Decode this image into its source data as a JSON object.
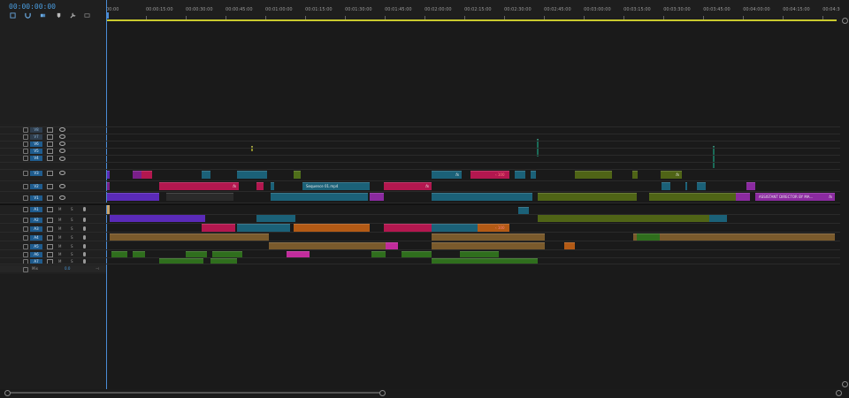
{
  "timecode": "00:00:00:00",
  "ruler": {
    "labels": [
      "00:00",
      "00:00:15:00",
      "00:00:30:00",
      "00:00:45:00",
      "00:01:00:00",
      "00:01:15:00",
      "00:01:30:00",
      "00:01:45:00",
      "00:02:00:00",
      "00:02:15:00",
      "00:02:30:00",
      "00:02:45:00",
      "00:03:00:00",
      "00:03:15:00",
      "00:03:30:00",
      "00:03:45:00",
      "00:04:00:00",
      "00:04:15:00",
      "00:04:30:00"
    ]
  },
  "video_tracks": [
    "V8",
    "V7",
    "V6",
    "V5",
    "V4",
    "V3",
    "V2",
    "V1"
  ],
  "audio_tracks": [
    "A1",
    "A2",
    "A3",
    "A4",
    "A5",
    "A6",
    "A7"
  ],
  "master": {
    "label": "Mix",
    "value": "0.0"
  },
  "audio_buttons": {
    "mute": "M",
    "solo": "S"
  },
  "clips": {
    "sequence_label": "Sequence 01.mp4",
    "assistant_label": "ASSISTANT DIRECTOR BY MA...",
    "fx": "fx",
    "speed_badge": "‹ 100",
    "speed_badge2": "‹ 100"
  },
  "colors": {
    "purple": "#5a2ab8",
    "magenta": "#b3174f",
    "teal": "#1b6178",
    "olive": "#6b7a1a",
    "green": "#2f6e1d",
    "orange": "#b35a15",
    "brown": "#7a5a2c",
    "pink": "#c12c9c",
    "violet": "#8b2aa0",
    "playhead": "#4a8cd6",
    "timecode": "#4a9de0"
  }
}
